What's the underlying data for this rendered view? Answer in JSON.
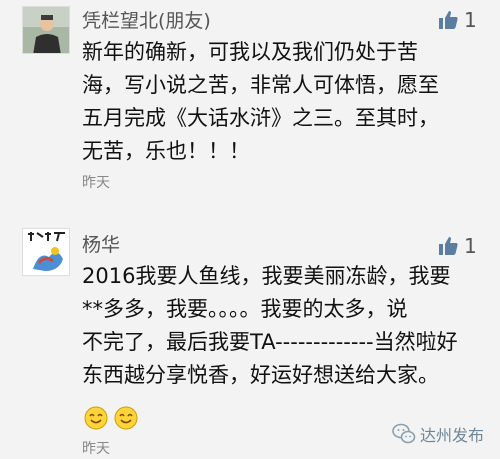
{
  "comments": [
    {
      "author": "凭栏望北(朋友)",
      "likes": "1",
      "lines": [
        "新年的确新，可我以及我们仍处于苦",
        "海，写小说之苦，非常人可体悟，愿至",
        "五月完成《大话水浒》之三。至其时，",
        "无苦，乐也！！！"
      ],
      "time": "昨天",
      "avatar_icon": "person-portrait-icon"
    },
    {
      "author": "杨华",
      "likes": "1",
      "lines": [
        "2016我要人鱼线，我要美丽冻龄，我要",
        "**多多，我要。。。。我要的太多，说",
        "不完了，最后我要TA-------------当然啦好",
        "东西越分享悦香，好运好想送给大家。"
      ],
      "emojis": [
        "smile-emoji",
        "smile-emoji"
      ],
      "time": "昨天",
      "avatar_icon": "calligraphy-artwork-icon"
    }
  ],
  "watermark": {
    "label": "达州发布",
    "icon": "wechat-icon"
  },
  "colors": {
    "background": "#f3f3f3",
    "accent": "#5b7ea0"
  }
}
